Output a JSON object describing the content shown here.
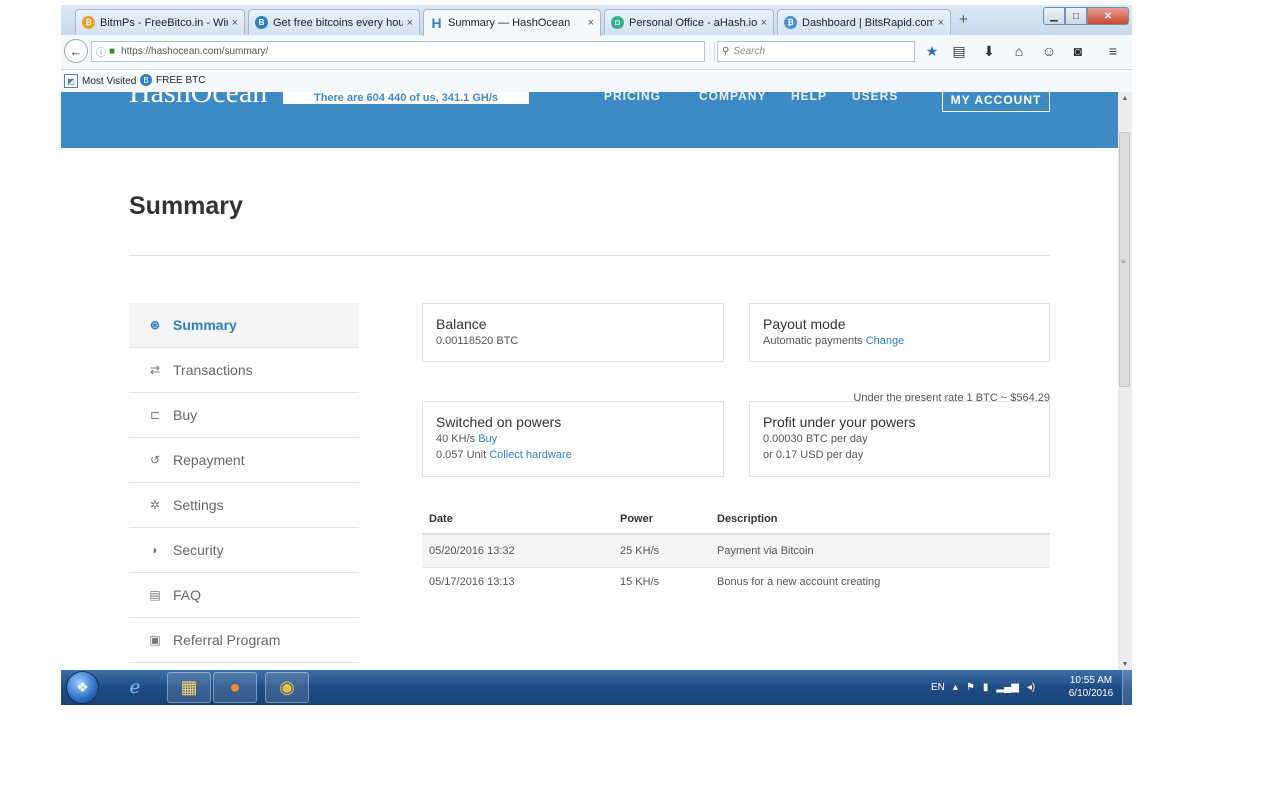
{
  "browser": {
    "tabs": [
      {
        "title": "BitmPs - FreeBitco.in - Win...",
        "favicon_color": "#f29a1f",
        "favicon_glyph": "₿",
        "close": "×"
      },
      {
        "title": "Get free bitcoins every hou...",
        "favicon_color": "#2f7fc0",
        "favicon_glyph": "B",
        "close": "×"
      },
      {
        "title": "Summary — HashOcean",
        "favicon_color": "#2f7fc0",
        "favicon_glyph": "H",
        "close": "×"
      },
      {
        "title": "Personal Office - aHash.io",
        "favicon_color": "#2fb38a",
        "favicon_glyph": "◘",
        "close": "×"
      },
      {
        "title": "Dashboard | BitsRapid.com",
        "favicon_color": "#4a90d9",
        "favicon_glyph": "₿",
        "close": "×"
      }
    ],
    "new_tab": "+",
    "url": "https://hashocean.com/summary/",
    "search_placeholder": "Search",
    "bookmarks": [
      {
        "label": "Most Visited",
        "icon": "bookmark-folder-icon"
      },
      {
        "label": "FREE BTC",
        "icon": "bitcoin-icon"
      }
    ],
    "window_buttons": {
      "minimize": "▁",
      "maximize": "□",
      "close": "✕"
    },
    "accent_color": "#3d8ac5"
  },
  "site": {
    "logo": "HashOcean",
    "users_count": "There are 604 440 of us, 341.1 GH/s",
    "nav": [
      "PRICING",
      "COMPANY",
      "HELP",
      "USERS"
    ],
    "my_account": "MY ACCOUNT"
  },
  "page": {
    "title": "Summary",
    "sidebar": [
      {
        "label": "Summary",
        "icon": "dashboard-icon",
        "glyph": "⊛",
        "active": true
      },
      {
        "label": "Transactions",
        "icon": "transfer-icon",
        "glyph": "⇄",
        "active": false
      },
      {
        "label": "Buy",
        "icon": "cart-icon",
        "glyph": "⊏",
        "active": false
      },
      {
        "label": "Repayment",
        "icon": "history-icon",
        "glyph": "↺",
        "active": false
      },
      {
        "label": "Settings",
        "icon": "gear-icon",
        "glyph": "✲",
        "active": false
      },
      {
        "label": "Security",
        "icon": "shield-icon",
        "glyph": "◗",
        "active": false
      },
      {
        "label": "FAQ",
        "icon": "book-icon",
        "glyph": "▤",
        "active": false
      },
      {
        "label": "Referral Program",
        "icon": "money-icon",
        "glyph": "▣",
        "active": false
      }
    ],
    "balance": {
      "title": "Balance",
      "value": "0.00118520 BTC"
    },
    "payout": {
      "title": "Payout mode",
      "value": "Automatic payments",
      "link": "Change"
    },
    "rate_note": "Under the present rate 1 BTC ~ $564.29",
    "powers": {
      "title": "Switched on powers",
      "line1_value": "40 KH/s",
      "line1_link": "Buy",
      "line2_value": "0.057 Unit",
      "line2_link": "Collect hardware"
    },
    "profit": {
      "title": "Profit under your powers",
      "line1": "0.00030 BTC per day",
      "line2": "or 0.17 USD per day"
    },
    "table": {
      "headers": [
        "Date",
        "Power",
        "Description"
      ],
      "rows": [
        [
          "05/20/2016 13:32",
          "25 KH/s",
          "Payment via Bitcoin"
        ],
        [
          "05/17/2016 13:13",
          "15 KH/s",
          "Bonus for a new account creating"
        ]
      ]
    }
  },
  "taskbar": {
    "apps": [
      "internet-explorer-icon",
      "file-explorer-icon",
      "firefox-icon",
      "chrome-icon"
    ],
    "tray_lang": "EN",
    "time": "10:55 AM",
    "date": "6/10/2016"
  }
}
